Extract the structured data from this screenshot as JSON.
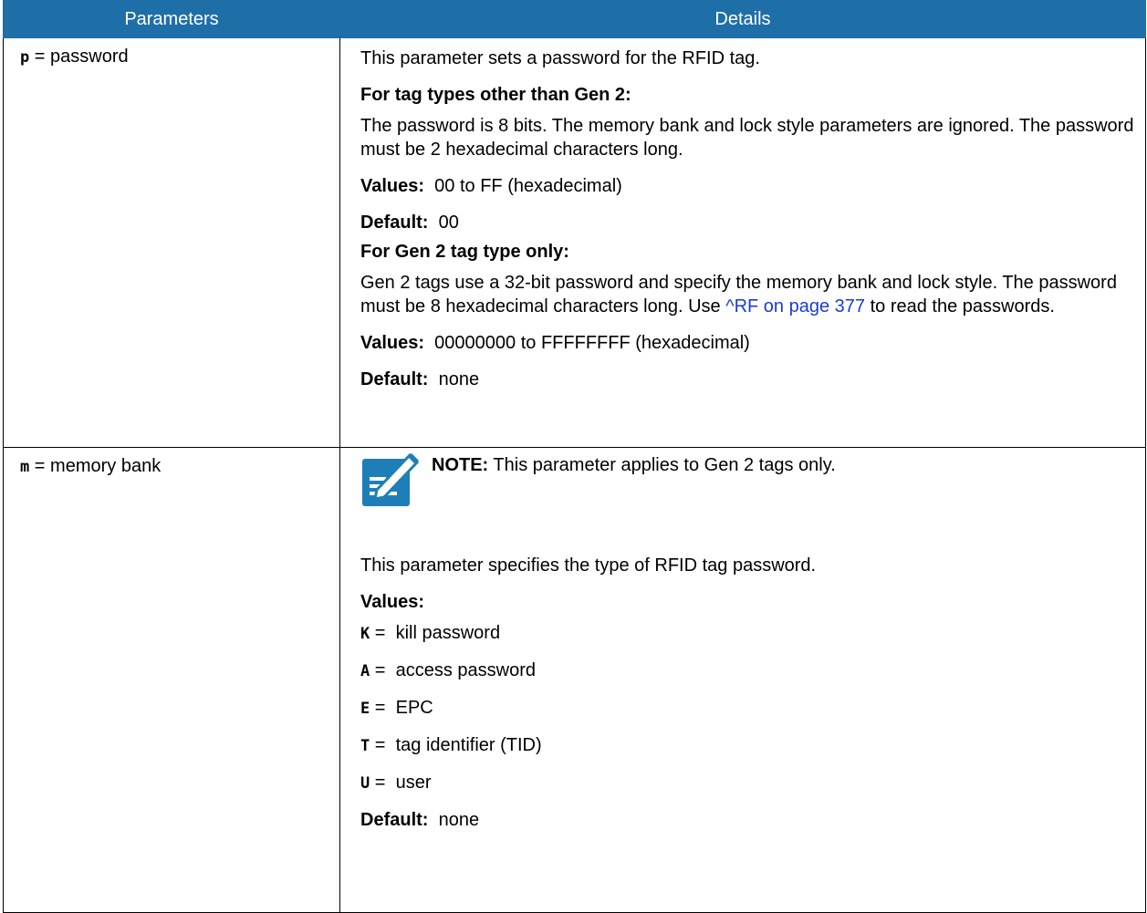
{
  "header": {
    "col1": "Parameters",
    "col2": "Details"
  },
  "rows": [
    {
      "key": "p",
      "name": "password",
      "intro": "This parameter sets a password for the RFID tag.",
      "section1_title": "For tag types other than Gen 2:",
      "section1_text": "The password is 8 bits. The memory bank and lock style parameters are ignored. The password must be 2 hexadecimal characters long.",
      "section1_values_label": "Values:",
      "section1_values": "00 to FF (hexadecimal)",
      "section1_default_label": "Default:",
      "section1_default": "00",
      "section2_title": "For Gen 2 tag type only:",
      "section2_text_before": "Gen 2 tags use a 32-bit password and specify the memory bank and lock style. The password must be 8 hexadecimal characters long. Use ",
      "section2_link": "^RF on page 377",
      "section2_text_after": " to read the passwords.",
      "section2_values_label": "Values:",
      "section2_values": "00000000 to FFFFFFFF (hexadecimal)",
      "section2_default_label": "Default:",
      "section2_default": "none"
    },
    {
      "key": "m",
      "name": "memory bank",
      "note_label": "NOTE:",
      "note_text": "This parameter applies to Gen 2 tags only.",
      "intro": "This parameter specifies the type of RFID tag password.",
      "values_label": "Values:",
      "values": [
        {
          "key": "K",
          "desc": "kill password"
        },
        {
          "key": "A",
          "desc": "access password"
        },
        {
          "key": "E",
          "desc": "EPC"
        },
        {
          "key": "T",
          "desc": "tag identifier (TID)"
        },
        {
          "key": "U",
          "desc": "user"
        }
      ],
      "default_label": "Default:",
      "default": "none"
    }
  ],
  "colors": {
    "header_bg": "#1e6fa8",
    "link": "#1a3cd6",
    "note_icon": "#1e7fb8"
  },
  "icons": {
    "note": "note-pencil-icon"
  }
}
